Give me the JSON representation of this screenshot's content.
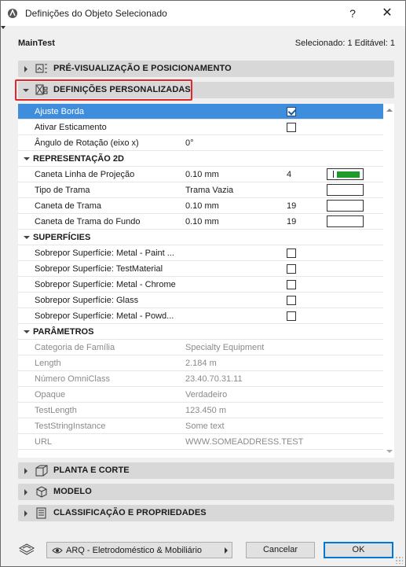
{
  "window": {
    "title": "Definições do Objeto Selecionado",
    "help_glyph": "?",
    "close_glyph": "✕"
  },
  "header": {
    "object_name": "MainTest",
    "selection_info": "Selecionado: 1 Editável: 1"
  },
  "sections": {
    "preview": "PRÉ-VISUALIZAÇÃO E POSICIONAMENTO",
    "custom": "DEFINIÇÕES PERSONALIZADAS",
    "floor_plan": "PLANTA E CORTE",
    "model": "MODELO",
    "classification": "CLASSIFICAÇÃO E PROPRIEDADES"
  },
  "rows": {
    "ajuste": {
      "label": "Ajuste Borda",
      "checked": true
    },
    "ativar": {
      "label": "Ativar Esticamento",
      "checked": false
    },
    "angulo": {
      "label": "Ângulo de Rotação (eixo x)",
      "value": "0°"
    },
    "group_2d": "REPRESENTAÇÃO 2D",
    "caneta_linha": {
      "label": "Caneta Linha de Projeção",
      "value": "0.10 mm",
      "pen": "4",
      "pen_color": "#1f9a2b"
    },
    "tipo_trama": {
      "label": "Tipo de Trama",
      "value": "Trama Vazia"
    },
    "caneta_trama": {
      "label": "Caneta de Trama",
      "value": "0.10 mm",
      "pen": "19"
    },
    "caneta_fundo": {
      "label": "Caneta de Trama do Fundo",
      "value": "0.10 mm",
      "pen": "19"
    },
    "group_surf": "SUPERFÍCIES",
    "surf1": "Sobrepor Superfície: Metal - Paint ...",
    "surf2": "Sobrepor Superfície: TestMaterial",
    "surf3": "Sobrepor Superfície: Metal - Chrome",
    "surf4": "Sobrepor Superfície: Glass",
    "surf5": "Sobrepor Superfície: Metal - Powd...",
    "group_params": "PARÂMETROS",
    "p1": {
      "label": "Categoria de Família",
      "value": "Specialty Equipment"
    },
    "p2": {
      "label": "Length",
      "value": "2.184 m"
    },
    "p3": {
      "label": "Número OmniClass",
      "value": "23.40.70.31.11"
    },
    "p4": {
      "label": "Opaque",
      "value": "Verdadeiro"
    },
    "p5": {
      "label": "TestLength",
      "value": "123.450 m"
    },
    "p6": {
      "label": "TestStringInstance",
      "value": "Some text"
    },
    "p7": {
      "label": "URL",
      "value": "WWW.SOMEADDRESS.TEST"
    }
  },
  "footer": {
    "layer": "ARQ - Eletrodoméstico & Mobiliário",
    "cancel": "Cancelar",
    "ok": "OK"
  },
  "colors": {
    "selection": "#3f8ddd",
    "highlight_frame": "#e4262b",
    "section_bar": "#d8d8d8"
  }
}
